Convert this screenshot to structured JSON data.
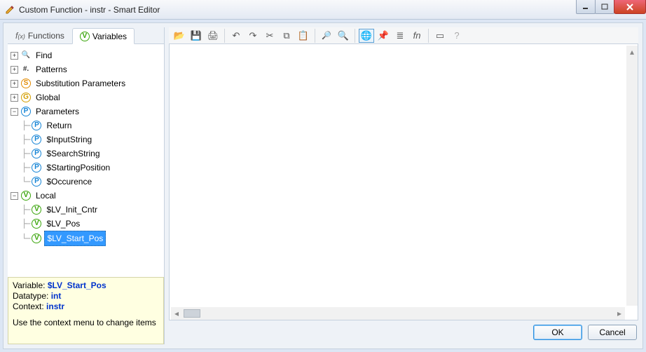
{
  "window": {
    "title": "Custom Function - instr - Smart Editor"
  },
  "tabs": {
    "functions": "Functions",
    "variables": "Variables"
  },
  "tree": {
    "find": "Find",
    "patterns": "Patterns",
    "substitution": "Substitution Parameters",
    "global": "Global",
    "parameters": "Parameters",
    "param_items": [
      "Return",
      "$InputString",
      "$SearchString",
      "$StartingPosition",
      "$Occurence"
    ],
    "local": "Local",
    "local_items": [
      "$LV_Init_Cntr",
      "$LV_Pos",
      "$LV_Start_Pos"
    ]
  },
  "info": {
    "variable_label": "Variable:",
    "variable_value": "$LV_Start_Pos",
    "datatype_label": "Datatype:",
    "datatype_value": "int",
    "context_label": "Context:",
    "context_value": "instr",
    "hint": "Use the context menu to change items"
  },
  "toolbar_icons": [
    "open",
    "save",
    "print",
    "undo",
    "redo",
    "cut",
    "copy",
    "paste",
    "find",
    "findnext",
    "globe",
    "bookmark",
    "list",
    "fn",
    "note",
    "help"
  ],
  "buttons": {
    "ok": "OK",
    "cancel": "Cancel"
  },
  "colors": {
    "selection": "#3399ff",
    "info_bg": "#ffffe1"
  }
}
